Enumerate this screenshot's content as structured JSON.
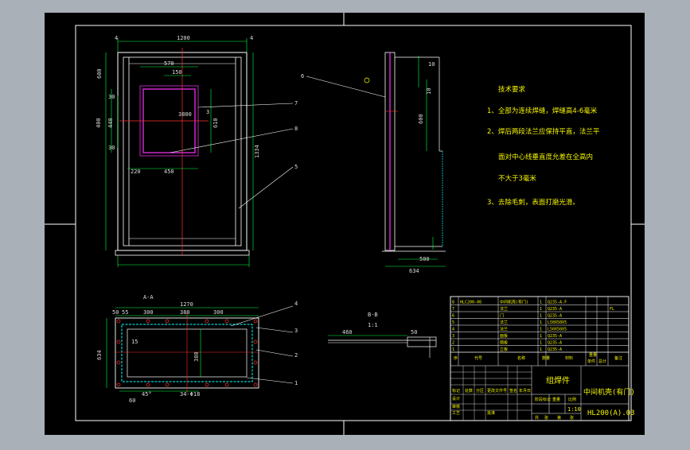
{
  "drawing": {
    "tech_req_title": "技术要求",
    "tech_req": [
      "1、全部为连续焊缝，焊缝高4-6毫米",
      "2、焊后两段法兰应保持平直，法兰平",
      "面对中心线垂直度允差在全高内",
      "不大于3毫米",
      "3、去除毛刺，表面打磨光滑。"
    ],
    "front_dims": [
      "4",
      "1200",
      "4",
      "570",
      "150",
      "600",
      "400",
      "440",
      "30",
      "30",
      "610",
      "220",
      "450",
      "3",
      "3800",
      "1334"
    ],
    "side_dims": [
      "10",
      "10",
      "600",
      "500",
      "634"
    ],
    "section_aa": {
      "label": "A-A",
      "dims": [
        "1270",
        "50",
        "55",
        "300",
        "380",
        "300",
        "634",
        "15",
        "380",
        "34-Φ18",
        "60",
        "45°"
      ]
    },
    "section_bb": {
      "label": "B-B",
      "scale": "1:1",
      "dims": [
        "460",
        "50"
      ]
    },
    "balloons": [
      "6",
      "7",
      "8",
      "5",
      "4",
      "3",
      "2",
      "1"
    ],
    "title_block": {
      "part_rows": [
        {
          "code": "HLC200-06",
          "name": "中间机壳(有门)",
          "qty": "1",
          "material": "Q235-A.F",
          "remark": ""
        },
        {
          "code": "",
          "name": "法兰",
          "qty": "1",
          "material": "Q235-A",
          "remark": "FL"
        },
        {
          "code": "",
          "name": "门",
          "qty": "1",
          "material": "Q235-A",
          "remark": ""
        },
        {
          "code": "",
          "name": "法兰",
          "qty": "1",
          "material": "L50X50X5",
          "remark": ""
        },
        {
          "code": "",
          "name": "法兰",
          "qty": "1",
          "material": "L50X50X5",
          "remark": ""
        },
        {
          "code": "",
          "name": "面板",
          "qty": "1",
          "material": "Q235-A",
          "remark": ""
        },
        {
          "code": "",
          "name": "侧板",
          "qty": "1",
          "material": "Q235-A",
          "remark": ""
        },
        {
          "code": "",
          "name": "立板",
          "qty": "1",
          "material": "Q235-A",
          "remark": ""
        }
      ],
      "headers": [
        "序",
        "代号",
        "名称",
        "数量",
        "材料",
        "单件",
        "总计",
        "备注"
      ],
      "weight_header": "重量",
      "drawing_name": "组焊件",
      "product_name": "中间机壳(有门)",
      "drawing_no": "HL200(A).03",
      "scale": "1:10",
      "sign_labels": [
        "标记",
        "处数",
        "分区",
        "更改文件号",
        "签名",
        "年月日"
      ],
      "role_labels": [
        "设计",
        "审核",
        "工艺",
        "批准"
      ],
      "extra_labels": [
        "阶段标记",
        "重量",
        "比例",
        "共",
        "张",
        "第",
        "张"
      ]
    }
  }
}
